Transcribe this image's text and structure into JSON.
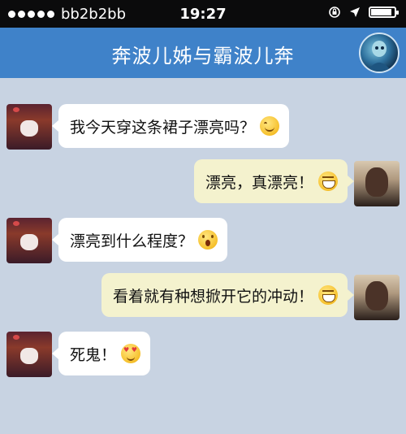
{
  "status_bar": {
    "carrier": "bb2b2bb",
    "time": "19:27",
    "signal_bars": 5,
    "battery_level": 0.9
  },
  "header": {
    "title": "奔波儿姊与霸波儿奔"
  },
  "messages": [
    {
      "side": "left",
      "text": "我今天穿这条裙子漂亮吗？",
      "emoji": "smile-emoji"
    },
    {
      "side": "right",
      "text": "漂亮，真漂亮！",
      "emoji": "grin-emoji"
    },
    {
      "side": "left",
      "text": "漂亮到什么程度？",
      "emoji": "surprised-emoji"
    },
    {
      "side": "right",
      "text": "看着就有种想掀开它的冲动！",
      "emoji": "grin-emoji"
    },
    {
      "side": "left",
      "text": "死鬼！",
      "emoji": "love-eyes-emoji"
    }
  ],
  "colors": {
    "header": "#3f82c9",
    "background": "#c8d3e2",
    "left_bubble": "#ffffff",
    "right_bubble": "#f4f2ce"
  }
}
